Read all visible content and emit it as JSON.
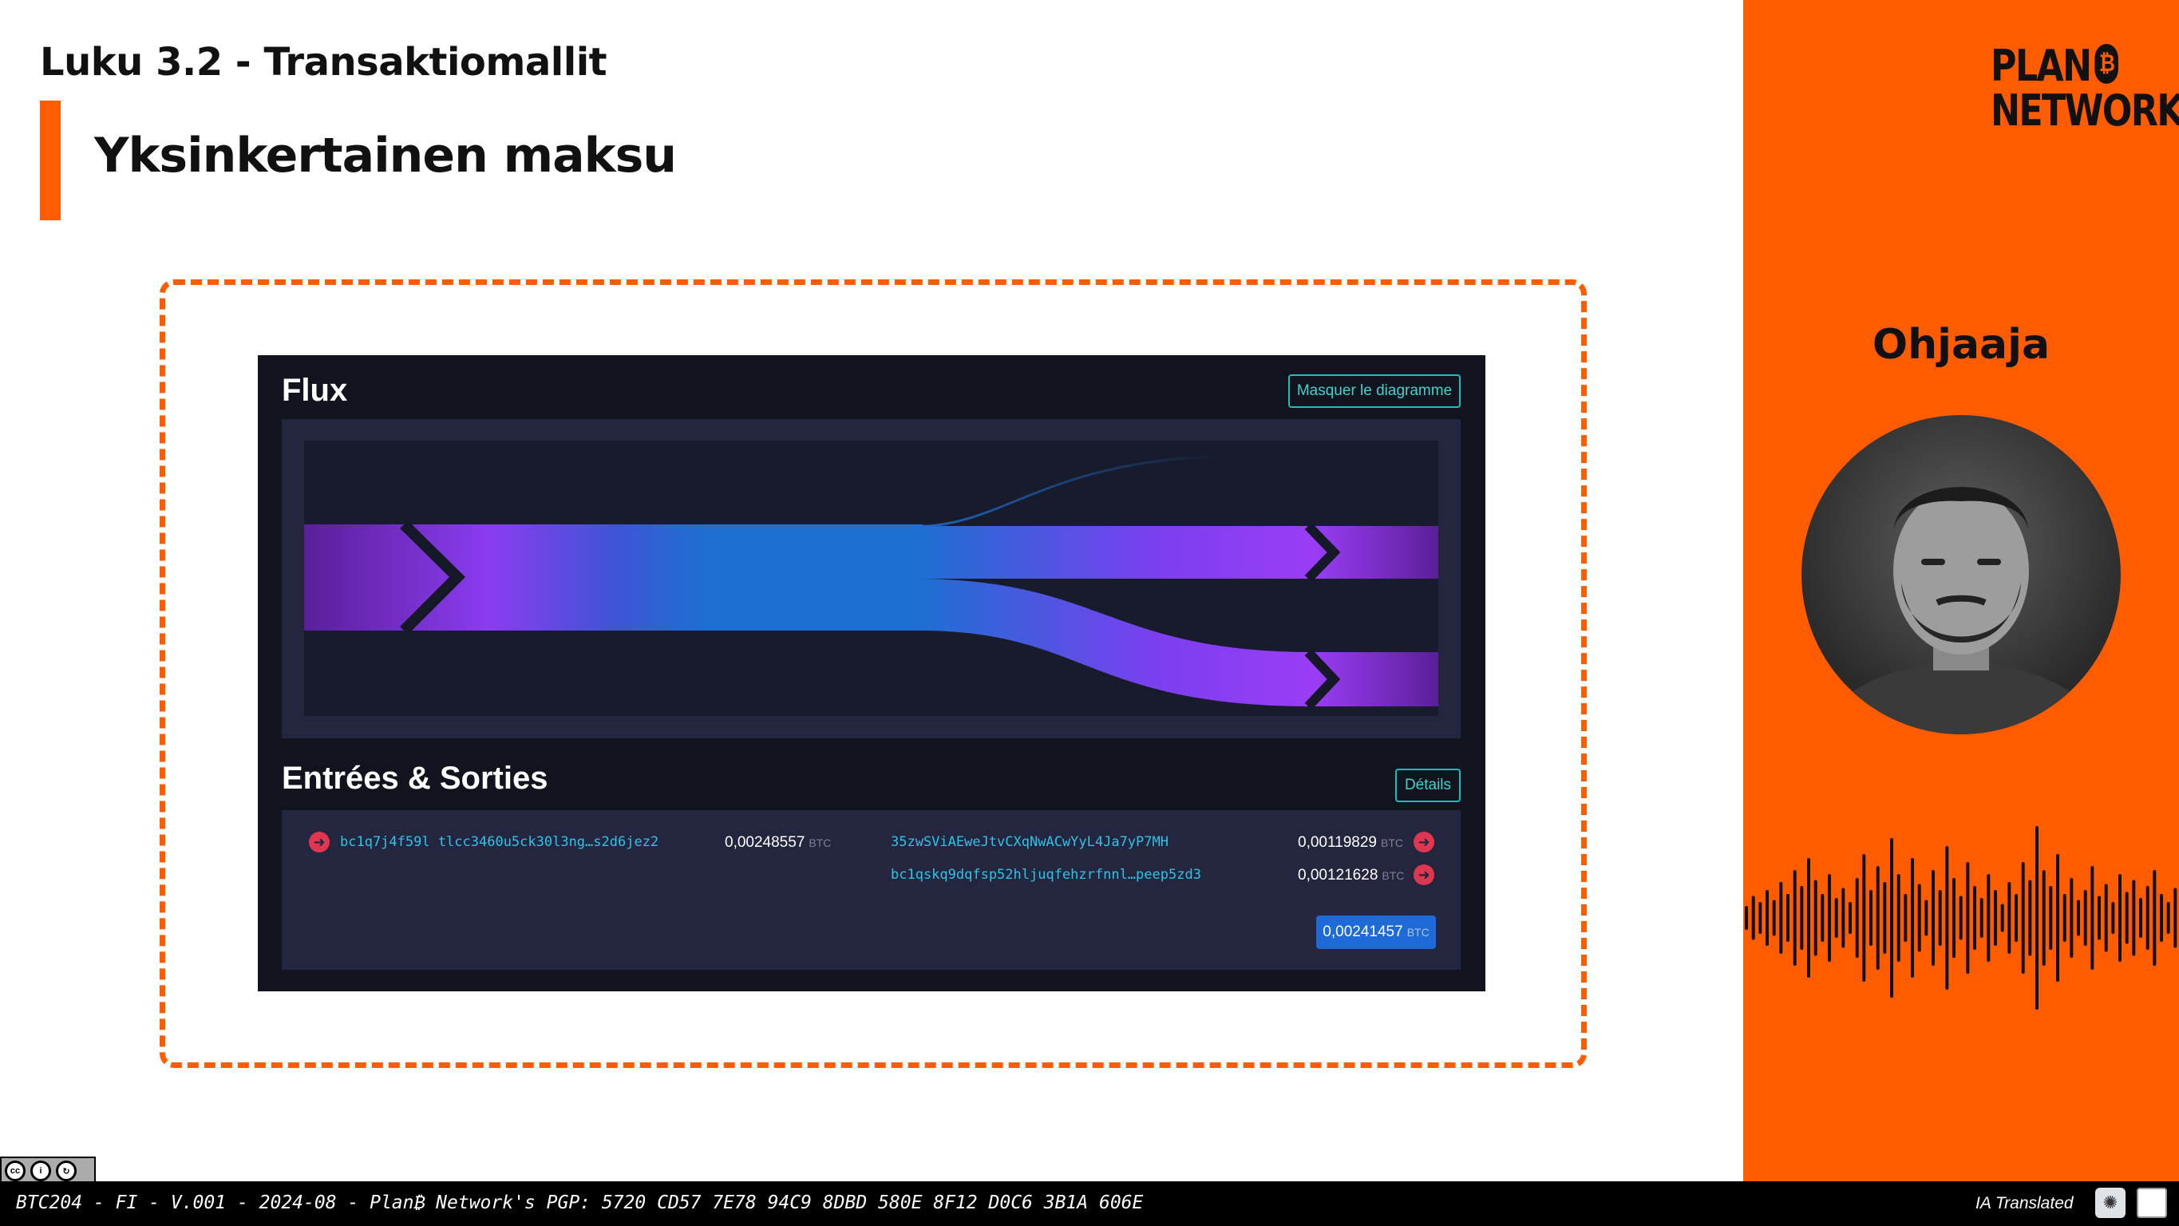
{
  "slide": {
    "chapter": "Luku 3.2 - Transaktiomallit",
    "section_title": "Yksinkertainen maksu"
  },
  "panel": {
    "flux_title": "Flux",
    "hide_diagram_label": "Masquer le diagramme",
    "io_title": "Entrées & Sorties",
    "details_label": "Détails",
    "unit": "BTC",
    "input": {
      "address": "bc1q7j4f59l tlcc3460u5ck30l3ng…s2d6jez2",
      "amount": "0,00248557"
    },
    "outputs": [
      {
        "address": "35zwSViAEweJtvCXqNwACwYyL4Ja7yP7MH",
        "amount": "0,00119829"
      },
      {
        "address": "bc1qskq9dqfsp52hljuqfehzrfnnl…peep5zd3",
        "amount": "0,00121628"
      }
    ],
    "total": "0,00241457"
  },
  "sidebar": {
    "logo_line1": "PLAN",
    "logo_coin": "₿",
    "logo_line2": "NETWORK",
    "role": "Ohjaaja"
  },
  "footer": {
    "text": "BTC204 - FI - V.001 - 2024-08 - Plan₿ Network's PGP: 5720 CD57 7E78 94C9 8DBD 580E 8F12 D0C6 3B1A 606E",
    "ia_label": "IA Translated",
    "license": "CC BY-SA"
  },
  "icons": {
    "input_arrow": "arrow-right-circle-icon",
    "output_arrow": "arrow-right-circle-icon",
    "ai": "openai-icon",
    "doc": "document-icon"
  },
  "colors": {
    "accent": "#ff5c00",
    "panel_bg": "#11141f",
    "flow_purple": "#8b3cf0",
    "flow_blue": "#1d6fd1",
    "address": "#31c2e7",
    "arrow": "#e0364f"
  }
}
